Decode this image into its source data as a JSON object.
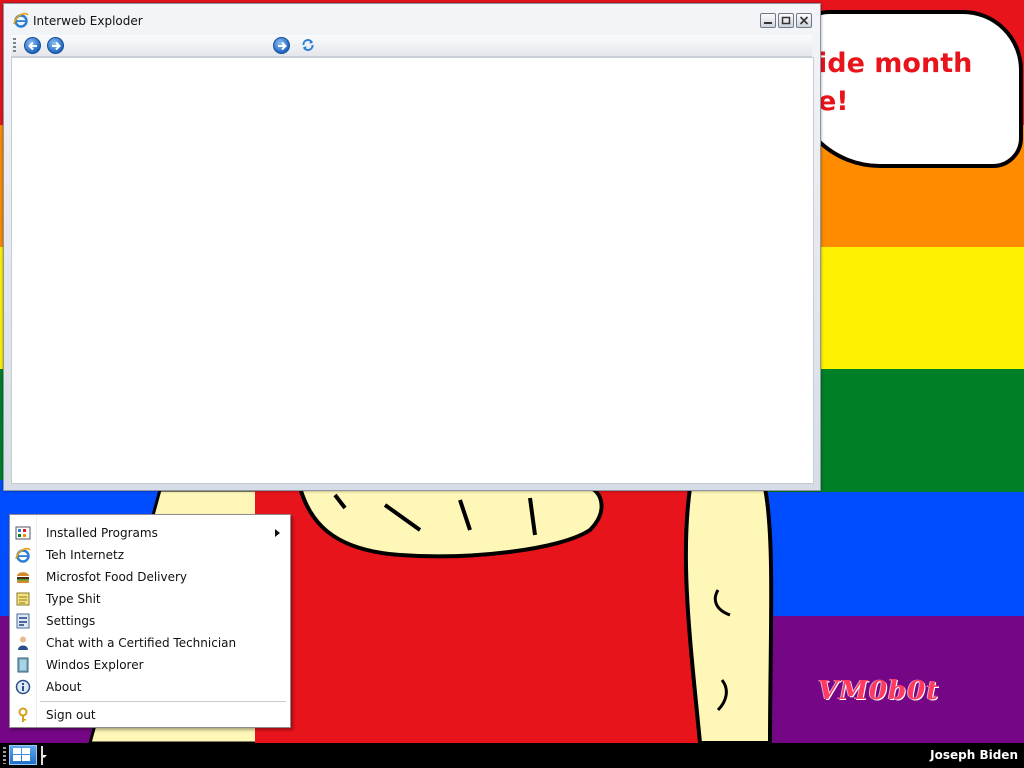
{
  "desktop": {
    "banner_text": "ide month\ne!",
    "watermark": "VM0b0t"
  },
  "window": {
    "title": "Interweb Exploder",
    "icon": "internet-explorer-icon",
    "buttons": [
      "minimize-icon",
      "maximize-icon",
      "close-icon"
    ],
    "toolbar": [
      "back-icon",
      "forward-icon",
      "go-icon",
      "refresh-icon"
    ]
  },
  "start_menu": {
    "items": [
      {
        "label": "Installed Programs",
        "icon": "programs-icon",
        "submenu": true
      },
      {
        "label": "Teh Internetz",
        "icon": "internet-explorer-icon"
      },
      {
        "label": "Microsfot Food Delivery",
        "icon": "burger-icon"
      },
      {
        "label": "Type Shit",
        "icon": "notepad-icon"
      },
      {
        "label": "Settings",
        "icon": "settings-icon"
      },
      {
        "label": "Chat with a Certified Technician",
        "icon": "technician-icon"
      },
      {
        "label": "Windos Explorer",
        "icon": "explorer-icon"
      },
      {
        "label": "About",
        "icon": "about-icon"
      },
      {
        "label": "Sign out",
        "icon": "key-icon"
      }
    ]
  },
  "taskbar": {
    "start_icon": "windows-logo-icon",
    "user_name": "Joseph Biden"
  },
  "colors": {
    "rainbow": [
      "#e8141c",
      "#ff8c00",
      "#fff200",
      "#008026",
      "#004dff",
      "#750787"
    ],
    "banner_text": "#e8141c"
  }
}
